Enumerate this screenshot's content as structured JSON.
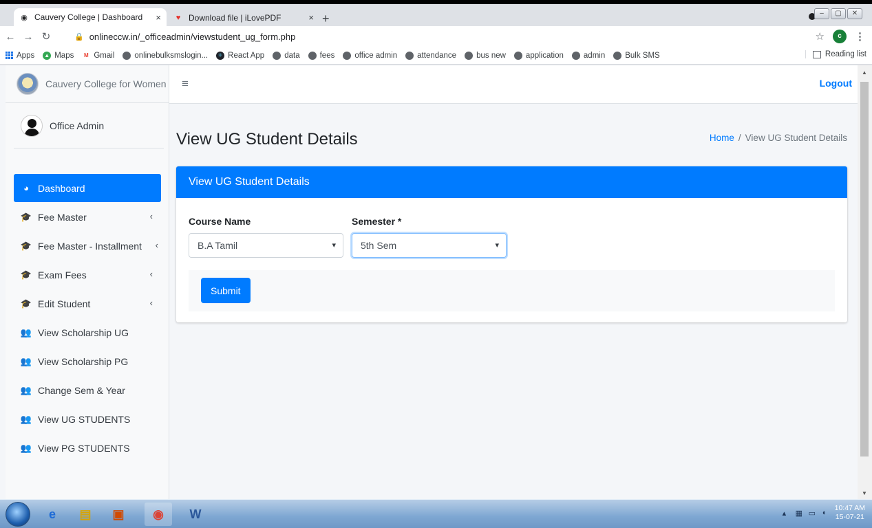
{
  "browser": {
    "tabs": [
      {
        "title": "Cauvery College | Dashboard",
        "close": "×"
      },
      {
        "title": "Download file | iLovePDF",
        "close": "×"
      }
    ],
    "new_tab": "+",
    "url": "onlineccw.in/_officeadmin/viewstudent_ug_form.php",
    "profile_initial": "c",
    "bookmarks": [
      "Apps",
      "Maps",
      "Gmail",
      "onlinebulksmslogin...",
      "React App",
      "data",
      "fees",
      "office admin",
      "attendance",
      "bus new",
      "application",
      "admin",
      "Bulk SMS"
    ],
    "reading_list": "Reading list"
  },
  "sidebar": {
    "brand": "Cauvery College for Women",
    "user": "Office Admin",
    "items": [
      {
        "label": "Dashboard"
      },
      {
        "label": "Fee Master"
      },
      {
        "label": "Fee Master - Installment"
      },
      {
        "label": "Exam Fees"
      },
      {
        "label": "Edit Student"
      },
      {
        "label": "View Scholarship UG"
      },
      {
        "label": "View Scholarship PG"
      },
      {
        "label": "Change Sem & Year"
      },
      {
        "label": "View UG STUDENTS"
      },
      {
        "label": "View PG STUDENTS"
      }
    ]
  },
  "topbar": {
    "logout": "Logout"
  },
  "content": {
    "title": "View UG Student Details",
    "breadcrumb": {
      "home": "Home",
      "sep": "/",
      "current": "View UG Student Details"
    },
    "card_title": "View UG Student Details",
    "course_label": "Course Name",
    "course_value": "B.A Tamil",
    "semester_label": "Semester *",
    "semester_value": "5th Sem",
    "submit": "Submit"
  },
  "taskbar": {
    "time": "10:47 AM",
    "date": "15-07-21"
  },
  "colors": {
    "primary": "#007bff",
    "sidebar_bg": "#f8f9fa",
    "page_bg": "#f4f6f9"
  }
}
